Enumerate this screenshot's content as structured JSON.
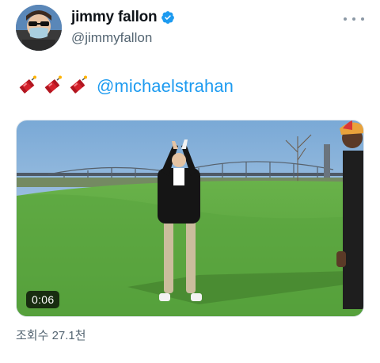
{
  "author": {
    "display_name": "jimmy fallon",
    "handle": "@jimmyfallon",
    "verified": true
  },
  "tweet": {
    "emojis": [
      "firecracker",
      "firecracker",
      "firecracker"
    ],
    "mention": "@michaelstrahan"
  },
  "video": {
    "duration": "0:06"
  },
  "stats": {
    "views": "조회수 27.1천"
  },
  "icons": {
    "verified": "verified-badge-icon",
    "more": "more-options-icon",
    "emoji": "firecracker-emoji"
  },
  "colors": {
    "link": "#1d9bf0",
    "secondary_text": "#536471",
    "verified": "#1d9bf0"
  }
}
